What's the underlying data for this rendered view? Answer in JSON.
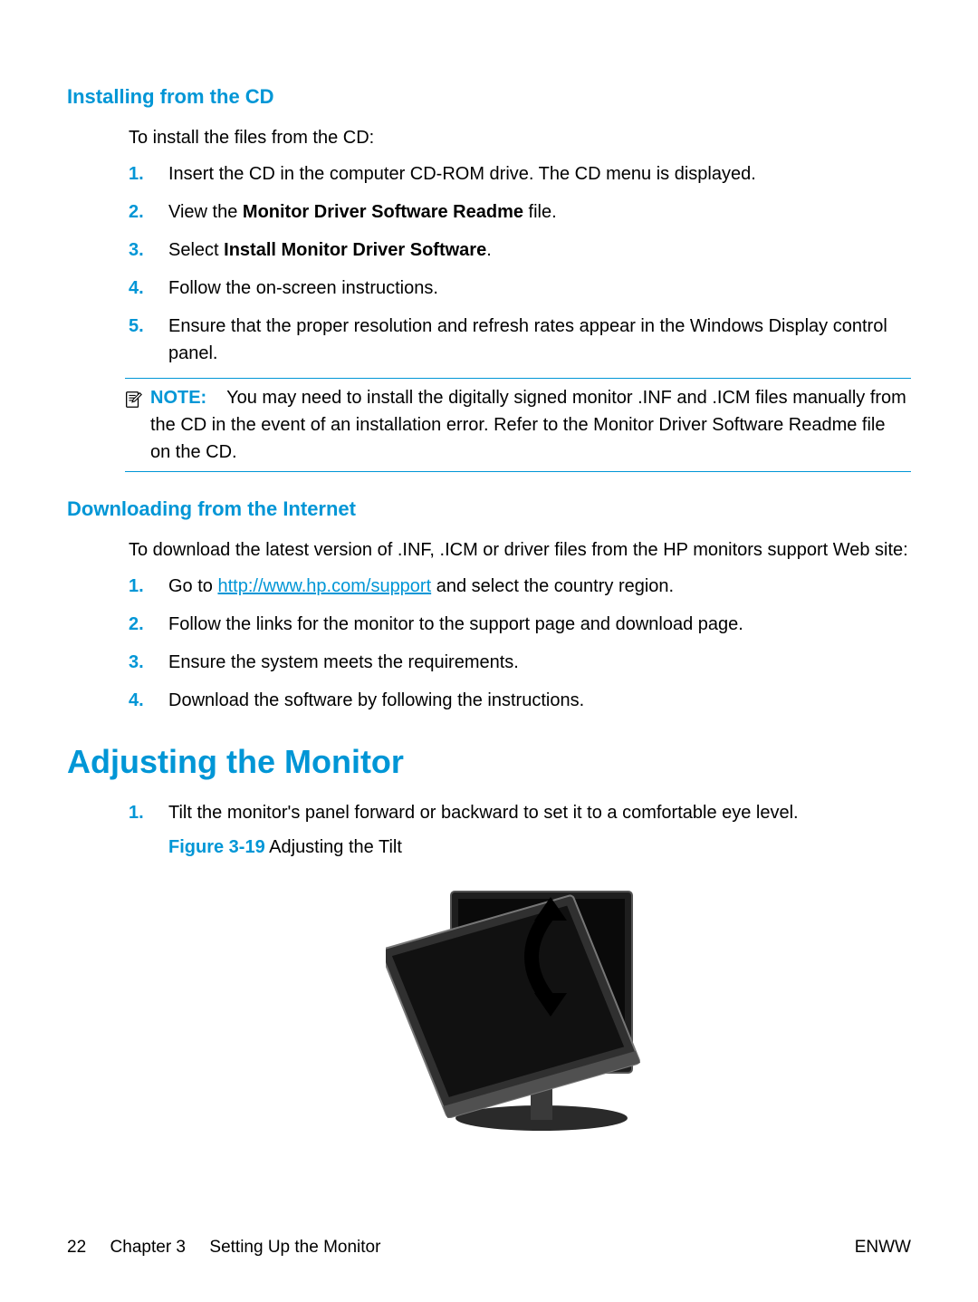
{
  "section1": {
    "heading": "Installing from the CD",
    "intro": "To install the files from the CD:",
    "steps": {
      "s1": {
        "num": "1.",
        "text": "Insert the CD in the computer CD-ROM drive. The CD menu is displayed."
      },
      "s2": {
        "num": "2.",
        "pre": "View the ",
        "bold": "Monitor Driver Software Readme",
        "post": " file."
      },
      "s3": {
        "num": "3.",
        "pre": "Select ",
        "bold": "Install Monitor Driver Software",
        "post": "."
      },
      "s4": {
        "num": "4.",
        "text": "Follow the on-screen instructions."
      },
      "s5": {
        "num": "5.",
        "text": "Ensure that the proper resolution and refresh rates appear in the Windows Display control panel."
      }
    },
    "note": {
      "label": "NOTE:",
      "text": "You may need to install the digitally signed monitor .INF and .ICM files manually from the CD in the event of an installation error. Refer to the Monitor Driver Software Readme file on the CD."
    }
  },
  "section2": {
    "heading": "Downloading from the Internet",
    "intro": "To download the latest version of .INF, .ICM or driver files from the HP monitors support Web site:",
    "steps": {
      "s1": {
        "num": "1.",
        "pre": "Go to ",
        "link": "http://www.hp.com/support",
        "post": " and select the country region."
      },
      "s2": {
        "num": "2.",
        "text": "Follow the links for the monitor to the support page and download page."
      },
      "s3": {
        "num": "3.",
        "text": "Ensure the system meets the requirements."
      },
      "s4": {
        "num": "4.",
        "text": "Download the software by following the instructions."
      }
    }
  },
  "section3": {
    "heading": "Adjusting the Monitor",
    "steps": {
      "s1": {
        "num": "1.",
        "text": "Tilt the monitor's panel forward or backward to set it to a comfortable eye level."
      }
    },
    "figure": {
      "label": "Figure 3-19",
      "caption": "  Adjusting the Tilt"
    }
  },
  "footer": {
    "page": "22",
    "chapter_label": "Chapter 3",
    "chapter_title": "Setting Up the Monitor",
    "right": "ENWW"
  }
}
